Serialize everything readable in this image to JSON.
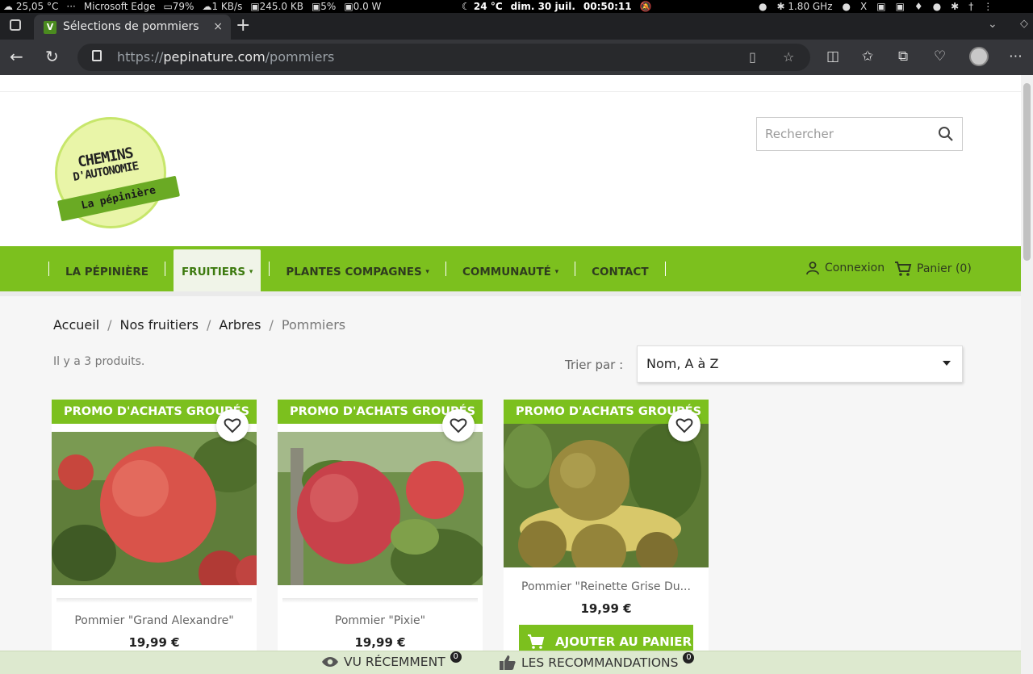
{
  "os_bar": {
    "left_items": [
      "☁ 25,05 °C",
      "···",
      "Microsoft Edge",
      "▭79%",
      "☁1 KB/s",
      "▣245.0 KB",
      "▣5%",
      "▣0.0 W"
    ],
    "center_items": [
      "☾ 24 °C",
      "dim. 30 juil.",
      "00:50:11",
      "🔕"
    ],
    "right_items": [
      "●",
      "✱ 1.80 GHz",
      "●",
      "X",
      "▣",
      "▣",
      "♦",
      "●",
      "✱",
      "†",
      "⋮"
    ]
  },
  "browser": {
    "tab_title": "Sélections de pommiers",
    "tab_favicon": "V",
    "tab_close": "×",
    "new_tab": "+",
    "url_scheme": "https://",
    "url_host": "pepinature.com",
    "url_path": "/pommiers"
  },
  "header": {
    "logo_line1": "CHEMINS",
    "logo_line2": "D'AUTONOMIE",
    "logo_ribbon": "La pépinière",
    "search_placeholder": "Rechercher"
  },
  "nav": {
    "items": [
      {
        "label": "LA PÉPINIÈRE",
        "dropdown": false
      },
      {
        "label": "FRUITIERS",
        "dropdown": true
      },
      {
        "label": "PLANTES COMPAGNES",
        "dropdown": true
      },
      {
        "label": "COMMUNAUTÉ",
        "dropdown": true
      },
      {
        "label": "CONTACT",
        "dropdown": false
      }
    ],
    "caret": "▾",
    "login": "Connexion",
    "cart": "Panier (0)"
  },
  "breadcrumb": {
    "items": [
      "Accueil",
      "Nos fruitiers",
      "Arbres",
      "Pommiers"
    ],
    "separator": "/"
  },
  "listing": {
    "count": "Il y a 3 produits.",
    "sort_label": "Trier par :",
    "sort_value": "Nom, A à Z"
  },
  "products": [
    {
      "promo": "PROMO D'ACHATS GROUPÉS",
      "name": "Pommier \"Grand Alexandre\"",
      "price": "19,99 €"
    },
    {
      "promo": "PROMO D'ACHATS GROUPÉS",
      "name": "Pommier \"Pixie\"",
      "price": "19,99 €"
    },
    {
      "promo": "PROMO D'ACHATS GROUPÉS",
      "name": "Pommier \"Reinette Grise Du...",
      "price": "19,99 €",
      "add_to_cart": "AJOUTER AU PANIER"
    }
  ],
  "footer_bar": {
    "recent": "VU RÉCEMMENT",
    "recent_count": "0",
    "recommend": "LES RECOMMANDATIONS",
    "recommend_count": "0"
  },
  "colors": {
    "brand_green": "#7cc01e",
    "nav_active_bg": "#f0f4e8",
    "footer_bg": "#dde9cf"
  }
}
